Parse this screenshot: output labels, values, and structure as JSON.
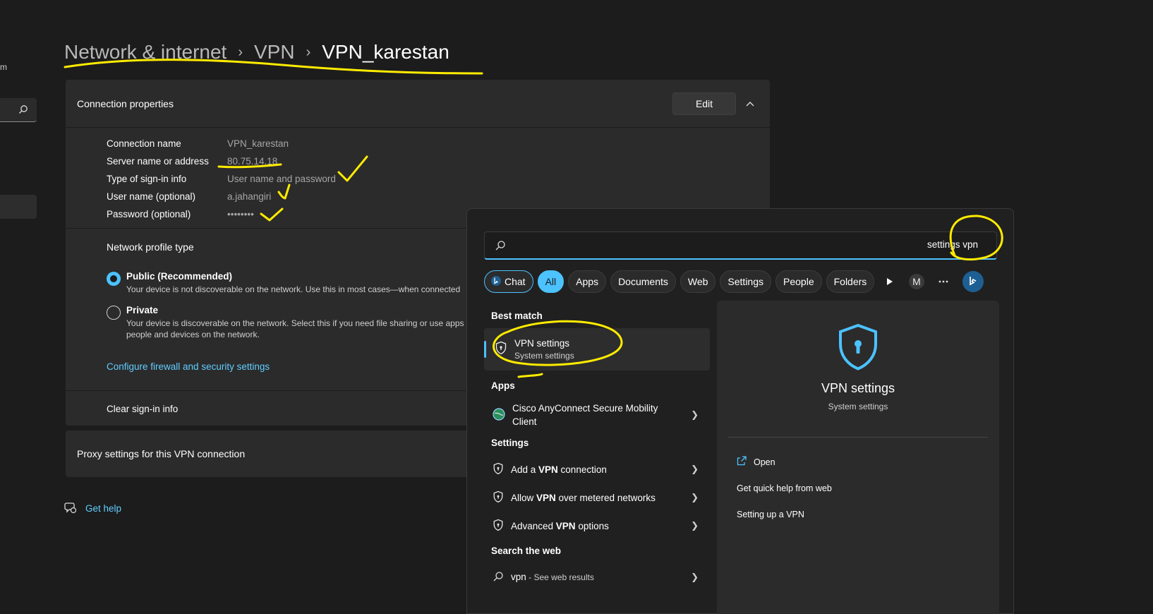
{
  "left_nav": {
    "fragment": "m"
  },
  "breadcrumb": {
    "level1": "Network & internet",
    "level2": "VPN",
    "current": "VPN_karestan"
  },
  "connection_properties": {
    "title": "Connection properties",
    "edit_label": "Edit",
    "rows": [
      {
        "key": "Connection name",
        "value": "VPN_karestan"
      },
      {
        "key": "Server name or address",
        "value": "80.75.14.18"
      },
      {
        "key": "Type of sign-in info",
        "value": "User name and password"
      },
      {
        "key": "User name (optional)",
        "value": "a.jahangiri"
      },
      {
        "key": "Password (optional)",
        "value": "••••••••"
      }
    ]
  },
  "network_profile": {
    "label": "Network profile type",
    "options": [
      {
        "title": "Public (Recommended)",
        "desc": "Your device is not discoverable on the network. Use this in most cases—when connected",
        "selected": true
      },
      {
        "title": "Private",
        "desc": "Your device is discoverable on the network. Select this if you need file sharing or use apps",
        "desc2": "people and devices on the network.",
        "selected": false
      }
    ],
    "firewall_link": "Configure firewall and security settings"
  },
  "clear_signin": "Clear sign-in info",
  "proxy": "Proxy settings for this VPN connection",
  "help": "Get help",
  "search": {
    "query": "settings vpn",
    "filters": [
      "Chat",
      "All",
      "Apps",
      "Documents",
      "Web",
      "Settings",
      "People",
      "Folders"
    ],
    "avatar_letter": "M",
    "best_match": {
      "section": "Best match",
      "title": "VPN settings",
      "subtitle": "System settings"
    },
    "apps_section": "Apps",
    "apps": [
      {
        "title": "Cisco AnyConnect Secure Mobility",
        "title2": "Client"
      }
    ],
    "settings_section": "Settings",
    "settings": [
      {
        "pre": "Add a ",
        "bold": "VPN",
        "post": " connection"
      },
      {
        "pre": "Allow ",
        "bold": "VPN",
        "post": " over metered networks"
      },
      {
        "pre": "Advanced ",
        "bold": "VPN",
        "post": " options"
      }
    ],
    "web_section": "Search the web",
    "web": {
      "query": "vpn",
      "suffix": " - See web results"
    },
    "preview": {
      "title": "VPN settings",
      "subtitle": "System settings",
      "actions": [
        "Open",
        "Get quick help from web",
        "Setting up a VPN"
      ]
    }
  },
  "colors": {
    "accent": "#4cc2ff",
    "annotation": "#ffeb00",
    "background": "#1c1c1c"
  }
}
